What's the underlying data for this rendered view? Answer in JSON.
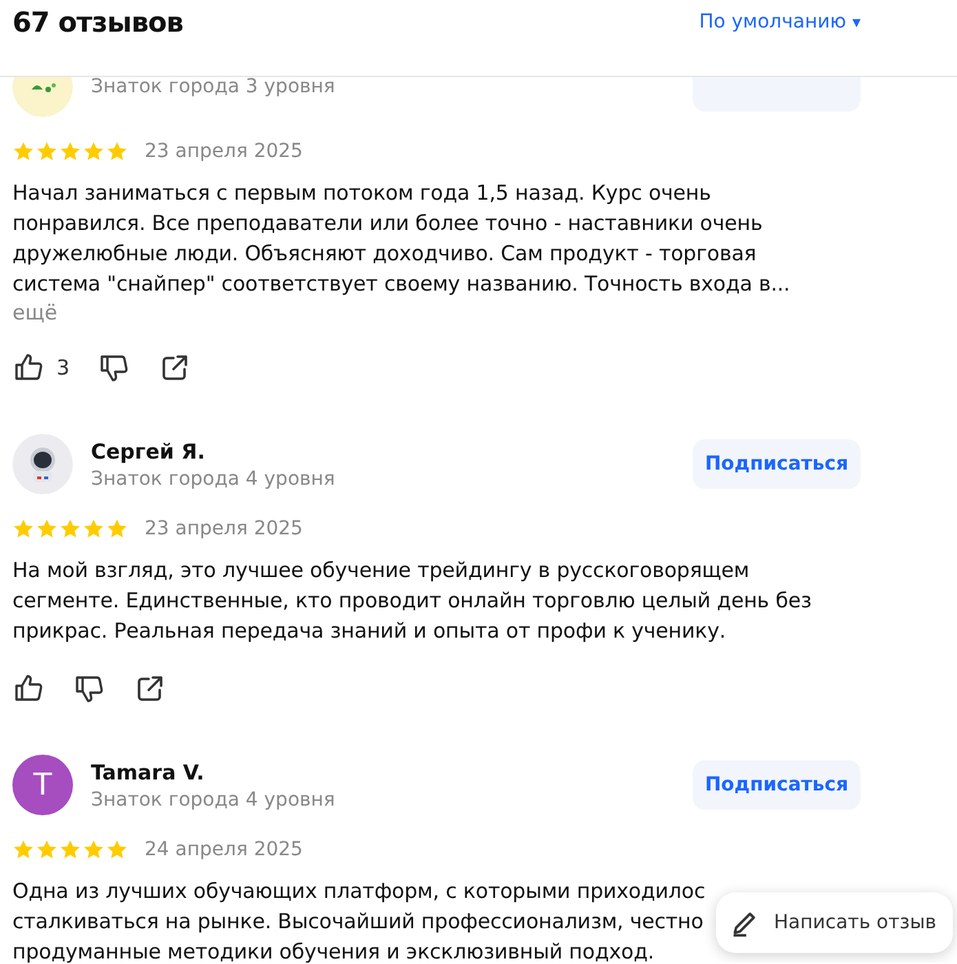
{
  "header": {
    "title": "67 отзывов",
    "sort": {
      "label": "По умолчанию",
      "caret": "▾"
    }
  },
  "reviews": [
    {
      "avatar": {
        "kind": "picture"
      },
      "level": "Знаток города 3 уровня",
      "stars": 5,
      "date": "23 апреля 2025",
      "lines": [
        "Начал заниматься с первым потоком года 1,5 назад. Курс очень",
        "понравился. Все преподаватели или более точно - наставники очень",
        "дружелюбные люди. Объясняют доходчиво. Сам продукт - торговая",
        "система \"снайпер\" соответствует своему названию. Точность входа в..."
      ],
      "more": "ещё",
      "likes": "3"
    },
    {
      "avatar": {
        "kind": "picture"
      },
      "name": "Сергей Я.",
      "level": "Знаток города 4 уровня",
      "subscribe": {
        "label": "Подписаться"
      },
      "stars": 5,
      "date": "23 апреля 2025",
      "lines": [
        "На мой взгляд, это лучшее обучение трейдингу в русскоговорящем",
        "сегменте. Единственные, кто проводит онлайн торговлю целый день без",
        "прикрас. Реальная передача знаний и опыта от профи к ученику."
      ]
    },
    {
      "avatar": {
        "kind": "letter",
        "letter": "T",
        "color": "#a64dc0"
      },
      "name": "Tamara V.",
      "level": "Знаток города 4 уровня",
      "subscribe": {
        "label": "Подписаться"
      },
      "stars": 5,
      "date": "24 апреля 2025",
      "lines": [
        "Одна из лучших обучающих платформ, с которыми приходилос",
        "сталкиваться на рынке. Высочайший профессионализм, честно",
        "продуманные методики обучения и эксклюзивный подход."
      ]
    }
  ],
  "write_button": {
    "label": "Написать отзыв"
  }
}
